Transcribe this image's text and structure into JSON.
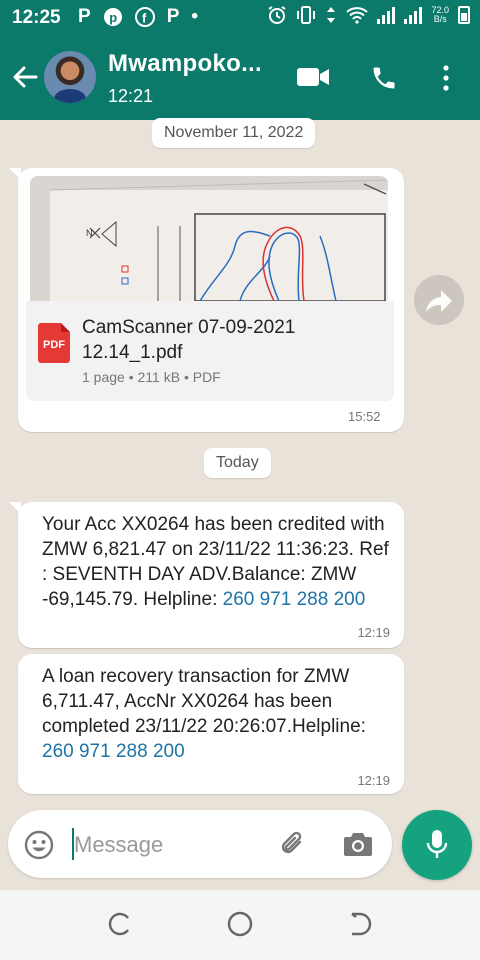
{
  "status_bar": {
    "time": "12:25",
    "notification_icons": [
      "P",
      "pinterest-icon",
      "facebook-icon",
      "P",
      "•"
    ],
    "net_speed_top": "72.0",
    "net_speed_bottom": "B/s",
    "battery_label": "battery-icon"
  },
  "header": {
    "contact_name": "Mwampoko...",
    "subtitle": "12:21"
  },
  "chat": {
    "date_1": "November 11, 2022",
    "document": {
      "file_name": "CamScanner 07-09-2021 12.14_1.pdf",
      "file_info": "1 page • 211 kB • PDF",
      "icon_label": "PDF",
      "time": "15:52"
    },
    "date_2": "Today",
    "messages": [
      {
        "text": "Your Acc XX0264 has been credited with ZMW 6,821.47 on 23/11/22 11:36:23. Ref : SEVENTH DAY ADV.Balance: ZMW -69,145.79. Helpline: ",
        "link": "260 971 288 200",
        "time": "12:19"
      },
      {
        "text": "A loan recovery transaction for ZMW 6,711.47, AccNr XX0264 has been completed 23/11/22 20:26:07.Helpline:  ",
        "link": "260 971 288 200",
        "time": "12:19"
      }
    ]
  },
  "composer": {
    "placeholder": "Message"
  },
  "colors": {
    "header_green": "#0b7a6b",
    "mic_green": "#15a37f",
    "link_blue": "#1e74a6",
    "chat_background": "#e9e2d9"
  }
}
